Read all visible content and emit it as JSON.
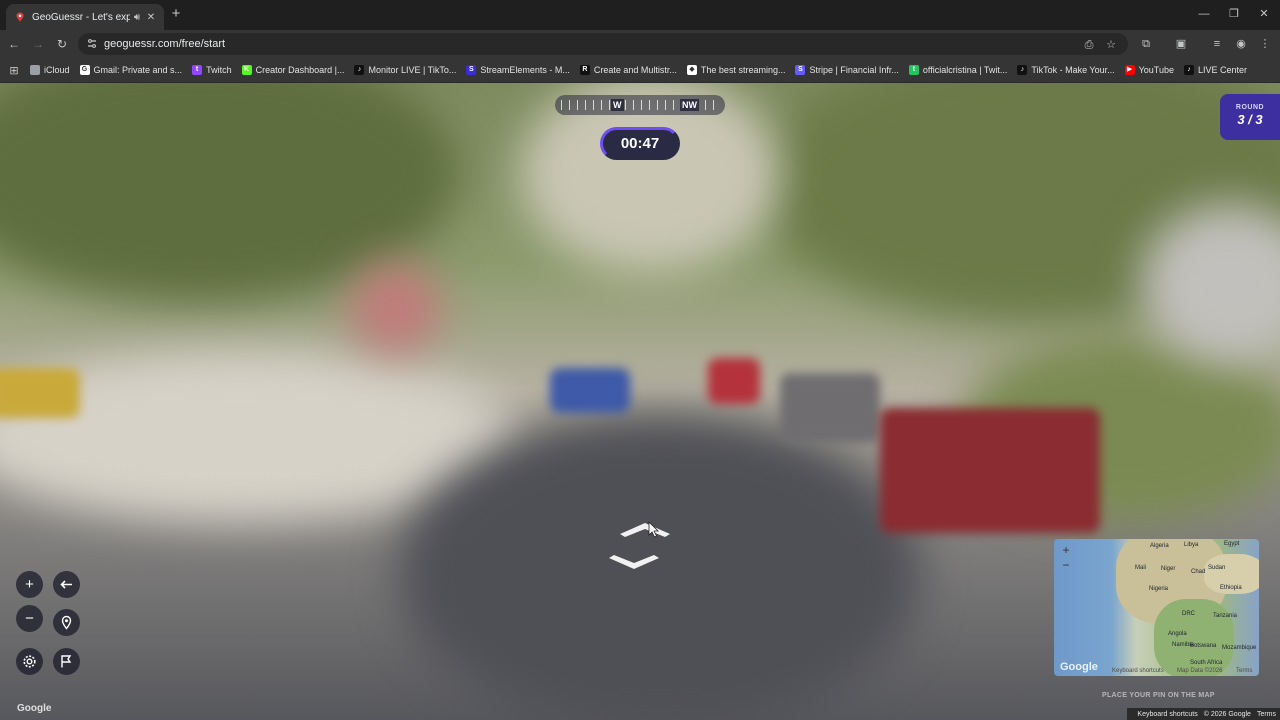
{
  "browser": {
    "tab_title": "GeoGuessr - Let's explore t",
    "url": "geoguessr.com/free/start"
  },
  "bookmarks": [
    {
      "label": "iCloud",
      "icon": "apple-icon",
      "color": "#9aa0a6"
    },
    {
      "label": "Gmail: Private and s...",
      "icon": "google-icon",
      "color": "#ffffff"
    },
    {
      "label": "Twitch",
      "icon": "twitch-icon",
      "color": "#9146ff"
    },
    {
      "label": "Creator Dashboard |...",
      "icon": "kick-icon",
      "color": "#53fc18"
    },
    {
      "label": "Monitor LIVE | TikTo...",
      "icon": "tiktok-icon",
      "color": "#111111"
    },
    {
      "label": "StreamElements - M...",
      "icon": "streamelements-icon",
      "color": "#3b2cd9"
    },
    {
      "label": "Create and Multistr...",
      "icon": "restream-icon",
      "color": "#111111"
    },
    {
      "label": "The best streaming...",
      "icon": "diamond-icon",
      "color": "#ffffff"
    },
    {
      "label": "Stripe | Financial Infr...",
      "icon": "stripe-icon",
      "color": "#635bff"
    },
    {
      "label": "officialcristina | Twit...",
      "icon": "twitch-green-icon",
      "color": "#22c55e"
    },
    {
      "label": "TikTok - Make Your...",
      "icon": "tiktok-icon",
      "color": "#111111"
    },
    {
      "label": "YouTube",
      "icon": "youtube-icon",
      "color": "#ff0000"
    },
    {
      "label": "LIVE Center",
      "icon": "tiktok-icon",
      "color": "#111111"
    }
  ],
  "game": {
    "compass": {
      "dir1": "W",
      "dir2": "NW"
    },
    "timer": "00:47",
    "round_label": "ROUND",
    "round_value": "3 / 3",
    "place_pin_text": "PLACE YOUR PIN ON THE MAP",
    "google_attribution": "Google"
  },
  "minimap": {
    "labels": [
      "Algeria",
      "Libya",
      "Egypt",
      "Mali",
      "Niger",
      "Chad",
      "Sudan",
      "Nigeria",
      "Ethiopia",
      "DRC",
      "Tanzania",
      "Angola",
      "Namibia",
      "Botswana",
      "South Africa",
      "Mozambique"
    ],
    "google": "Google",
    "shortcuts": "Keyboard shortcuts",
    "map_data": "Map Data ©2026",
    "terms": "Terms"
  },
  "footer": {
    "keyboard_shortcuts": "Keyboard shortcuts",
    "map_data": "© 2026 Google",
    "terms": "Terms"
  },
  "colors": {
    "accent": "#6c4ef2",
    "round_badge": "#3e2fa0"
  }
}
